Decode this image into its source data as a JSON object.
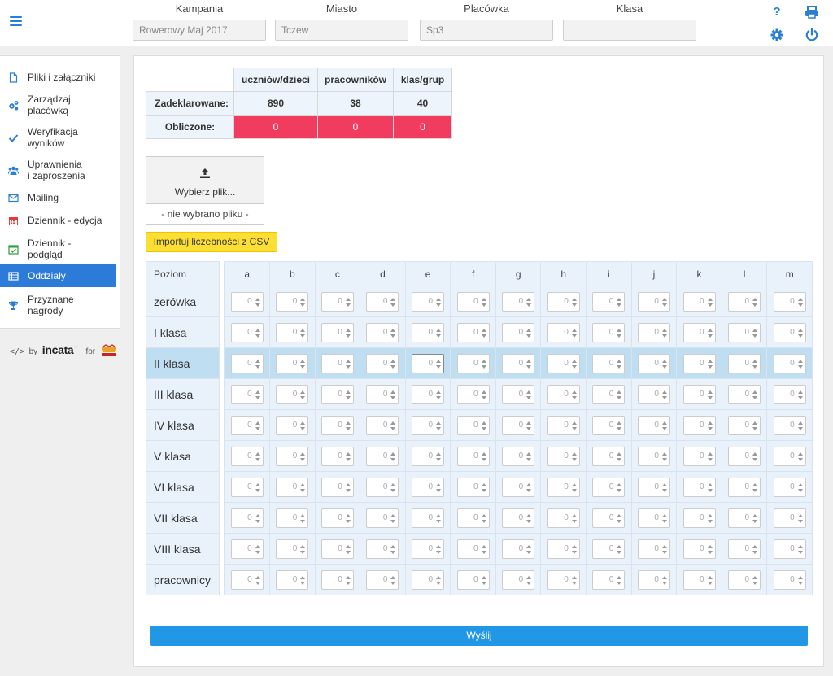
{
  "header": {
    "filters": [
      {
        "label": "Kampania",
        "value": "Rowerowy Maj 2017"
      },
      {
        "label": "Miasto",
        "value": "Tczew"
      },
      {
        "label": "Placówka",
        "value": "Sp3"
      },
      {
        "label": "Klasa",
        "value": ""
      }
    ],
    "help_symbol": "?",
    "icons": [
      "help-icon",
      "print-icon",
      "gear-icon",
      "power-icon"
    ]
  },
  "sidebar": {
    "items": [
      {
        "label": "Pliki i załączniki",
        "icon": "file-icon"
      },
      {
        "label": "Zarządzaj\nplacówką",
        "icon": "gears-icon"
      },
      {
        "label": "Weryfikacja\nwyników",
        "icon": "check-icon"
      },
      {
        "label": "Uprawnienia\ni zaproszenia",
        "icon": "users-icon"
      },
      {
        "label": "Mailing",
        "icon": "envelope-icon"
      },
      {
        "label": "Dziennik - edycja",
        "icon": "calendar-icon"
      },
      {
        "label": "Dziennik -\npodgląd",
        "icon": "calendar-check-icon"
      },
      {
        "label": "Oddziały",
        "icon": "table-icon",
        "active": true
      },
      {
        "label": "Przyznane\nnagrody",
        "icon": "trophy-icon"
      }
    ],
    "byline": {
      "by": "by",
      "brand": "incata",
      "for": "for"
    }
  },
  "summary": {
    "columns": [
      "uczniów/dzieci",
      "pracowników",
      "klas/grup"
    ],
    "declared_label": "Zadeklarowane:",
    "declared": [
      "890",
      "38",
      "40"
    ],
    "computed_label": "Obliczone:",
    "computed": [
      "0",
      "0",
      "0"
    ]
  },
  "upload": {
    "button_label": "Wybierz plik...",
    "no_file": "- nie wybrano pliku -",
    "import_label": "Importuj liczebności z CSV"
  },
  "grid": {
    "level_header": "Poziom",
    "columns": [
      "a",
      "b",
      "c",
      "d",
      "e",
      "f",
      "g",
      "h",
      "i",
      "j",
      "k",
      "l",
      "m"
    ],
    "rows": [
      "zerówka",
      "I klasa",
      "II klasa",
      "III klasa",
      "IV klasa",
      "V klasa",
      "VI klasa",
      "VII klasa",
      "VIII klasa",
      "pracownicy"
    ],
    "cell_value": "0",
    "highlighted_row": "II klasa",
    "focused_column": "e"
  },
  "submit_label": "Wyślij",
  "colors": {
    "accent": "#2d7bd8",
    "submit": "#2197e5",
    "warning": "#f13b5f",
    "import": "#fcdf32"
  }
}
